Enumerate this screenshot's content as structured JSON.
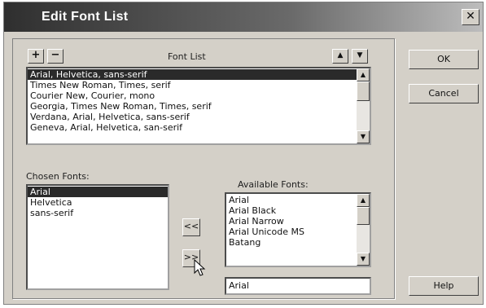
{
  "window": {
    "title": "Edit Font List",
    "close_icon": "close-icon"
  },
  "font_list": {
    "label": "Font List",
    "add_label": "+",
    "remove_label": "−",
    "up_icon": "arrow-up-icon",
    "down_icon": "arrow-down-icon",
    "items": [
      "Arial, Helvetica, sans-serif",
      "Times New Roman, Times, serif",
      "Courier New, Courier, mono",
      "Georgia, Times New Roman, Times, serif",
      "Verdana, Arial, Helvetica, sans-serif",
      "Geneva, Arial, Helvetica, san-serif"
    ],
    "selected_index": 0
  },
  "chosen_fonts": {
    "label": "Chosen Fonts:",
    "items": [
      "Arial",
      "Helvetica",
      "sans-serif"
    ],
    "selected_index": 0
  },
  "transfer": {
    "add_label": "<<",
    "remove_label": ">>"
  },
  "available_fonts": {
    "label": "Available Fonts:",
    "items": [
      "Arial",
      "Arial Black",
      "Arial Narrow",
      "Arial Unicode MS",
      "Batang"
    ],
    "input_value": "Arial"
  },
  "buttons": {
    "ok": "OK",
    "cancel": "Cancel",
    "help": "Help"
  }
}
